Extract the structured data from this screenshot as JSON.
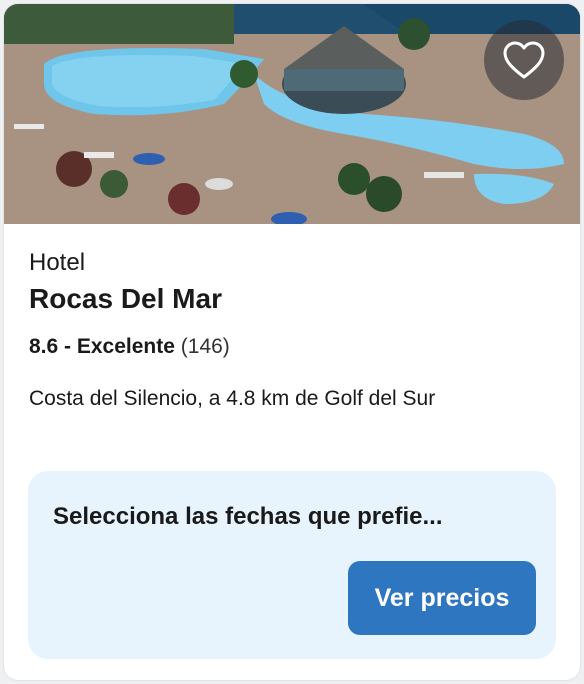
{
  "card": {
    "image_alt": "Vista aérea de piscinas del hotel junto al mar",
    "favorite_icon": "heart-outline-icon",
    "type": "Hotel",
    "name": "Rocas Del Mar",
    "rating": {
      "score_text": "8.6 - Excelente",
      "count_text": "(146)"
    },
    "location": "Costa del Silencio, a 4.8 km de Golf del Sur"
  },
  "cta": {
    "prompt": "Selecciona las fechas que prefie...",
    "button_label": "Ver precios"
  },
  "colors": {
    "button_bg": "#2f76c1",
    "cta_bg": "#e8f4fd"
  }
}
